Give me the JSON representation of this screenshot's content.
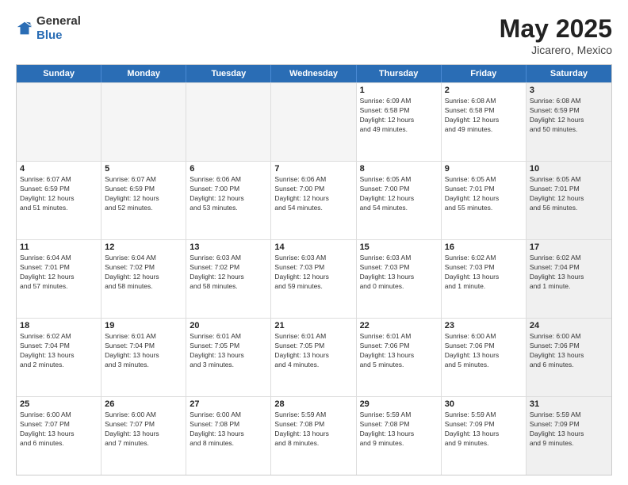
{
  "header": {
    "logo": {
      "line1": "General",
      "line2": "Blue"
    },
    "title": "May 2025",
    "location": "Jicarero, Mexico"
  },
  "calendar": {
    "days_of_week": [
      "Sunday",
      "Monday",
      "Tuesday",
      "Wednesday",
      "Thursday",
      "Friday",
      "Saturday"
    ],
    "rows": [
      [
        {
          "day": "",
          "empty": true
        },
        {
          "day": "",
          "empty": true
        },
        {
          "day": "",
          "empty": true
        },
        {
          "day": "",
          "empty": true
        },
        {
          "day": "1",
          "info": "Sunrise: 6:09 AM\nSunset: 6:58 PM\nDaylight: 12 hours\nand 49 minutes."
        },
        {
          "day": "2",
          "info": "Sunrise: 6:08 AM\nSunset: 6:58 PM\nDaylight: 12 hours\nand 49 minutes."
        },
        {
          "day": "3",
          "info": "Sunrise: 6:08 AM\nSunset: 6:59 PM\nDaylight: 12 hours\nand 50 minutes.",
          "shaded": true
        }
      ],
      [
        {
          "day": "4",
          "info": "Sunrise: 6:07 AM\nSunset: 6:59 PM\nDaylight: 12 hours\nand 51 minutes."
        },
        {
          "day": "5",
          "info": "Sunrise: 6:07 AM\nSunset: 6:59 PM\nDaylight: 12 hours\nand 52 minutes."
        },
        {
          "day": "6",
          "info": "Sunrise: 6:06 AM\nSunset: 7:00 PM\nDaylight: 12 hours\nand 53 minutes."
        },
        {
          "day": "7",
          "info": "Sunrise: 6:06 AM\nSunset: 7:00 PM\nDaylight: 12 hours\nand 54 minutes."
        },
        {
          "day": "8",
          "info": "Sunrise: 6:05 AM\nSunset: 7:00 PM\nDaylight: 12 hours\nand 54 minutes."
        },
        {
          "day": "9",
          "info": "Sunrise: 6:05 AM\nSunset: 7:01 PM\nDaylight: 12 hours\nand 55 minutes."
        },
        {
          "day": "10",
          "info": "Sunrise: 6:05 AM\nSunset: 7:01 PM\nDaylight: 12 hours\nand 56 minutes.",
          "shaded": true
        }
      ],
      [
        {
          "day": "11",
          "info": "Sunrise: 6:04 AM\nSunset: 7:01 PM\nDaylight: 12 hours\nand 57 minutes."
        },
        {
          "day": "12",
          "info": "Sunrise: 6:04 AM\nSunset: 7:02 PM\nDaylight: 12 hours\nand 58 minutes."
        },
        {
          "day": "13",
          "info": "Sunrise: 6:03 AM\nSunset: 7:02 PM\nDaylight: 12 hours\nand 58 minutes."
        },
        {
          "day": "14",
          "info": "Sunrise: 6:03 AM\nSunset: 7:03 PM\nDaylight: 12 hours\nand 59 minutes."
        },
        {
          "day": "15",
          "info": "Sunrise: 6:03 AM\nSunset: 7:03 PM\nDaylight: 13 hours\nand 0 minutes."
        },
        {
          "day": "16",
          "info": "Sunrise: 6:02 AM\nSunset: 7:03 PM\nDaylight: 13 hours\nand 1 minute."
        },
        {
          "day": "17",
          "info": "Sunrise: 6:02 AM\nSunset: 7:04 PM\nDaylight: 13 hours\nand 1 minute.",
          "shaded": true
        }
      ],
      [
        {
          "day": "18",
          "info": "Sunrise: 6:02 AM\nSunset: 7:04 PM\nDaylight: 13 hours\nand 2 minutes."
        },
        {
          "day": "19",
          "info": "Sunrise: 6:01 AM\nSunset: 7:04 PM\nDaylight: 13 hours\nand 3 minutes."
        },
        {
          "day": "20",
          "info": "Sunrise: 6:01 AM\nSunset: 7:05 PM\nDaylight: 13 hours\nand 3 minutes."
        },
        {
          "day": "21",
          "info": "Sunrise: 6:01 AM\nSunset: 7:05 PM\nDaylight: 13 hours\nand 4 minutes."
        },
        {
          "day": "22",
          "info": "Sunrise: 6:01 AM\nSunset: 7:06 PM\nDaylight: 13 hours\nand 5 minutes."
        },
        {
          "day": "23",
          "info": "Sunrise: 6:00 AM\nSunset: 7:06 PM\nDaylight: 13 hours\nand 5 minutes."
        },
        {
          "day": "24",
          "info": "Sunrise: 6:00 AM\nSunset: 7:06 PM\nDaylight: 13 hours\nand 6 minutes.",
          "shaded": true
        }
      ],
      [
        {
          "day": "25",
          "info": "Sunrise: 6:00 AM\nSunset: 7:07 PM\nDaylight: 13 hours\nand 6 minutes."
        },
        {
          "day": "26",
          "info": "Sunrise: 6:00 AM\nSunset: 7:07 PM\nDaylight: 13 hours\nand 7 minutes."
        },
        {
          "day": "27",
          "info": "Sunrise: 6:00 AM\nSunset: 7:08 PM\nDaylight: 13 hours\nand 8 minutes."
        },
        {
          "day": "28",
          "info": "Sunrise: 5:59 AM\nSunset: 7:08 PM\nDaylight: 13 hours\nand 8 minutes."
        },
        {
          "day": "29",
          "info": "Sunrise: 5:59 AM\nSunset: 7:08 PM\nDaylight: 13 hours\nand 9 minutes."
        },
        {
          "day": "30",
          "info": "Sunrise: 5:59 AM\nSunset: 7:09 PM\nDaylight: 13 hours\nand 9 minutes."
        },
        {
          "day": "31",
          "info": "Sunrise: 5:59 AM\nSunset: 7:09 PM\nDaylight: 13 hours\nand 9 minutes.",
          "shaded": true
        }
      ]
    ]
  }
}
